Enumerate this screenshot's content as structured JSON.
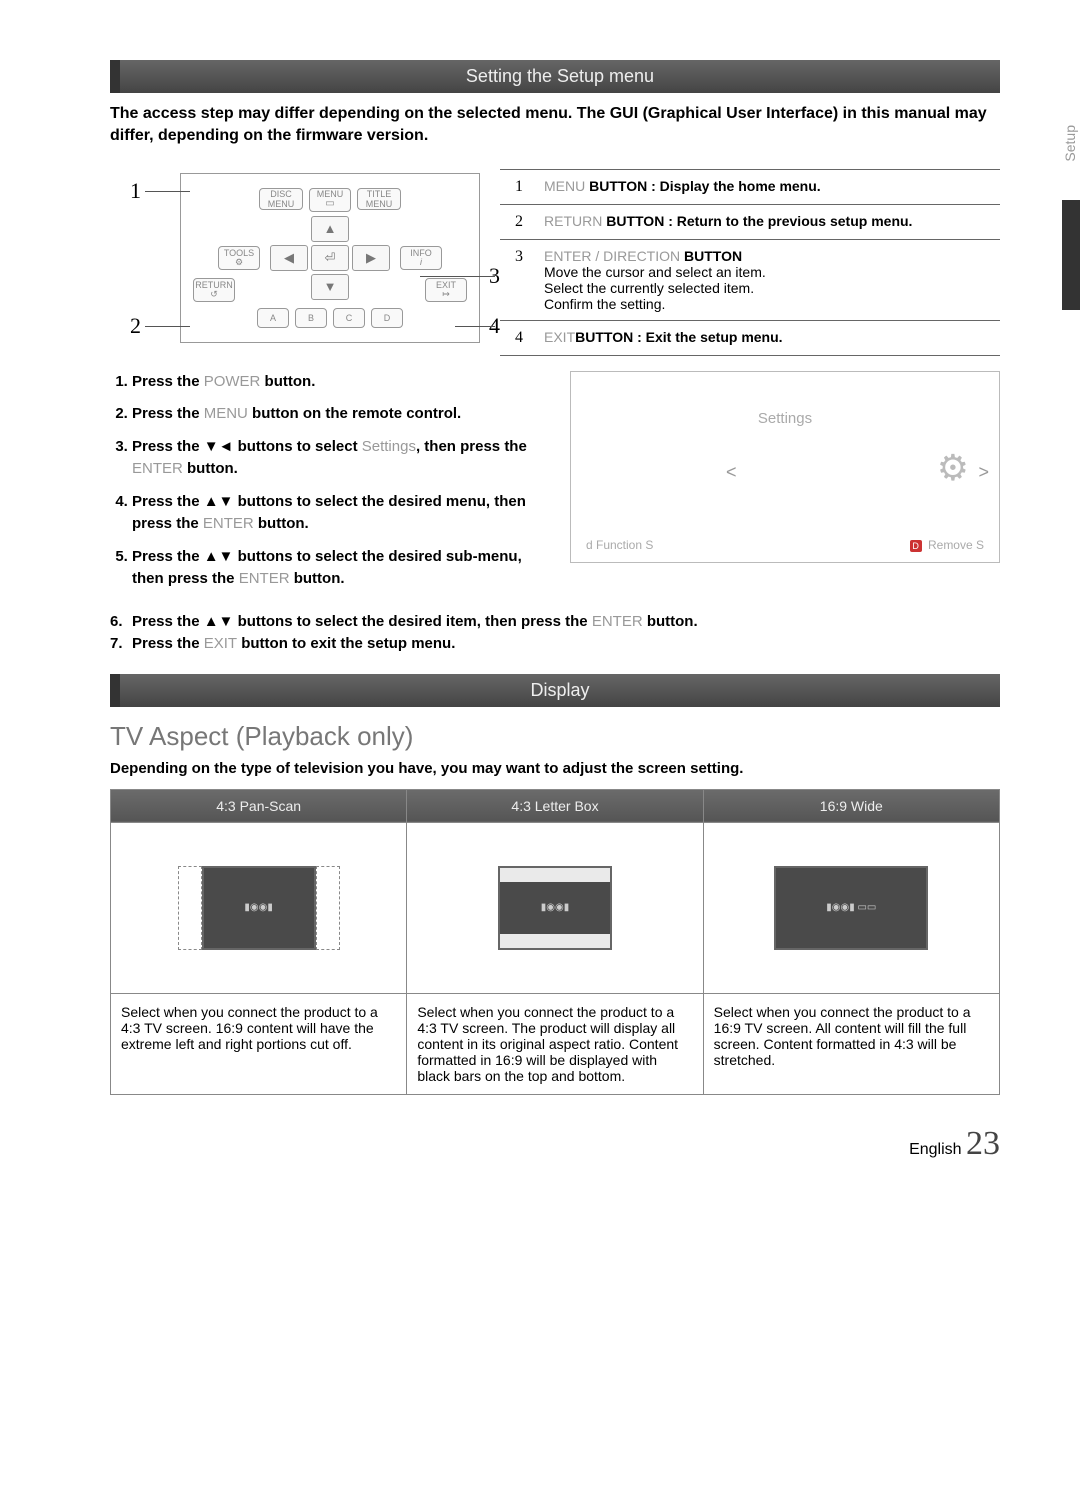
{
  "side_tab": "Setup",
  "bar1": "Setting the Setup menu",
  "intro": "The access step may differ depending on the selected menu. The GUI (Graphical User Interface) in this manual may differ, depending on the firmware version.",
  "remote_labels": {
    "disc_menu": "DISC MENU",
    "menu": "MENU",
    "title_menu": "TITLE MENU",
    "tools": "TOOLS",
    "info": "INFO",
    "return": "RETURN",
    "exit": "EXIT"
  },
  "callouts": {
    "c1": "1",
    "c2": "2",
    "c3": "3",
    "c4": "4"
  },
  "button_table": {
    "r1": {
      "num": "1",
      "label": "MENU",
      "desc": " BUTTON : Display the home menu."
    },
    "r2": {
      "num": "2",
      "label": "RETURN",
      "desc": " BUTTON : Return to the previous setup menu."
    },
    "r3": {
      "num": "3",
      "label": "ENTER / DIRECTION",
      "l1": "BUTTON",
      "l2": "Move the cursor and select an item.",
      "l3": "Select the currently selected item.",
      "l4": "Confirm the setting."
    },
    "r4": {
      "num": "4",
      "label": "EXIT",
      "desc": "BUTTON : Exit the setup menu."
    }
  },
  "steps": {
    "s1a": "Press the ",
    "s1b": "POWER",
    "s1c": " button.",
    "s2a": "Press the ",
    "s2b": "MENU",
    "s2c": " button on the remote control.",
    "s3a": "Press the ▼◄ buttons to select ",
    "s3b": "Settings",
    "s3c": ", then press the ",
    "s3d": "ENTER",
    "s3e": " button.",
    "s4a": "Press the ▲▼ buttons to select the desired menu, then press the ",
    "s4b": "ENTER",
    "s4c": " button.",
    "s5a": "Press the ▲▼ buttons to select the desired sub-menu, then press the ",
    "s5b": "ENTER",
    "s5c": " button.",
    "s6a": "Press the ▲▼ buttons to select the desired item, then press the ",
    "s6b": "ENTER",
    "s6c": " button.",
    "s7a": "Press the ",
    "s7b": "EXIT",
    "s7c": " button to exit the setup menu."
  },
  "settings_ui": {
    "title": "Settings",
    "left_label": "d Function",
    "left_control": "S",
    "right_icon": "D",
    "right_label": " Remove S"
  },
  "bar2": "Display",
  "h3": "TV Aspect (Playback only)",
  "sub_intro": "Depending on the type of television you have, you may want to adjust the screen setting.",
  "aspect": {
    "h1": "4:3 Pan-Scan",
    "h2": "4:3 Letter Box",
    "h3": "16:9 Wide",
    "d1": "Select when you connect the product to a 4:3 TV screen. 16:9 content will have the extreme left and right portions cut off.",
    "d2": "Select when you connect the product to a 4:3 TV screen. The product will display all content in its original aspect ratio. Content formatted in 16:9 will be displayed with black bars on the top and bottom.",
    "d3": "Select when you connect the product to a 16:9 TV screen. All content will fill the full screen. Content formatted in 4:3 will be stretched."
  },
  "page_lang": "English",
  "page_num": "23"
}
